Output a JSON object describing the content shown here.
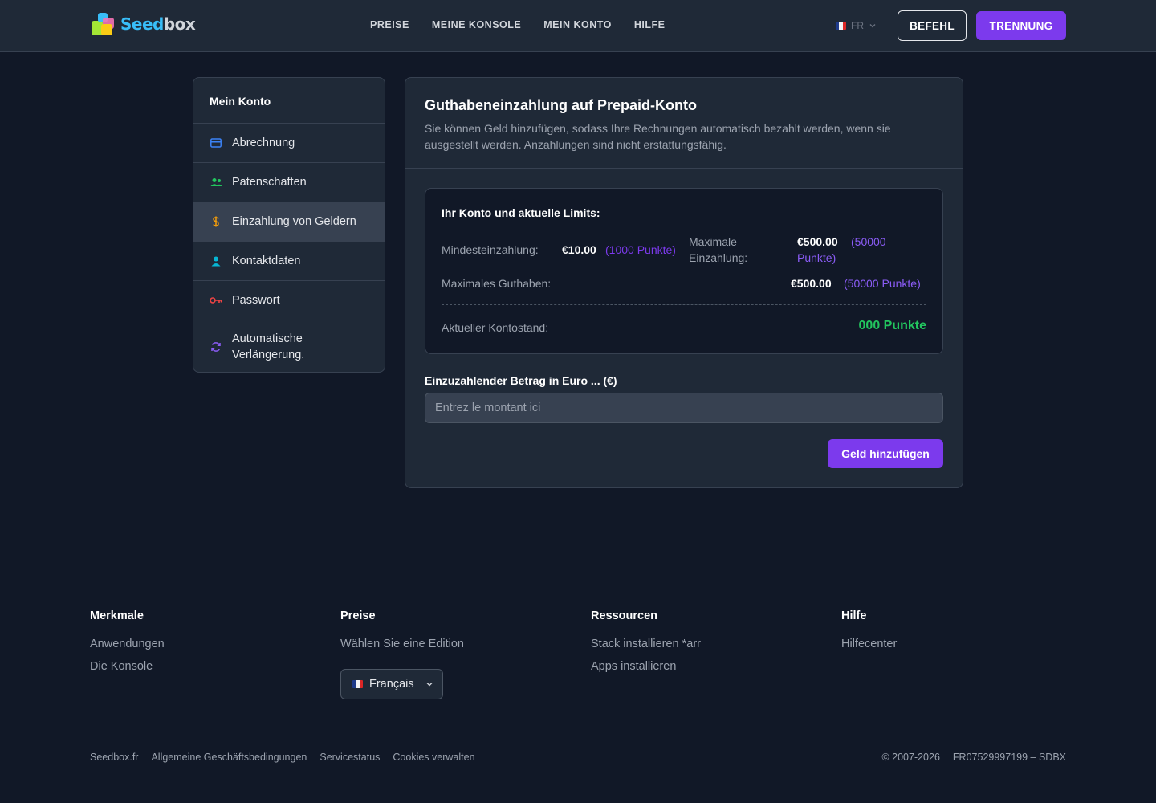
{
  "header": {
    "logo_a": "Seed",
    "logo_b": "box",
    "nav": [
      "PREISE",
      "MEINE KONSOLE",
      "MEIN KONTO",
      "HILFE"
    ],
    "lang": "FR",
    "btn_order": "BEFEHL",
    "btn_logout": "TRENNUNG"
  },
  "sidebar": {
    "title": "Mein Konto",
    "items": [
      {
        "label": "Abrechnung",
        "icon": "credit-card-icon",
        "color": "#3b82f6"
      },
      {
        "label": "Patenschaften",
        "icon": "users-icon",
        "color": "#22c55e"
      },
      {
        "label": "Einzahlung von Geldern",
        "icon": "dollar-icon",
        "color": "#f59e0b"
      },
      {
        "label": "Kontaktdaten",
        "icon": "user-icon",
        "color": "#06b6d4"
      },
      {
        "label": "Passwort",
        "icon": "key-icon",
        "color": "#ef4444"
      },
      {
        "label": "Automatische Verlängerung.",
        "icon": "refresh-icon",
        "color": "#8b5cf6"
      }
    ],
    "active_index": 2
  },
  "main": {
    "title": "Guthabeneinzahlung auf Prepaid-Konto",
    "description": "Sie können Geld hinzufügen, sodass Ihre Rechnungen automatisch bezahlt werden, wenn sie ausgestellt werden. Anzahlungen sind nicht erstattungsfähig.",
    "limits": {
      "title": "Ihr Konto und aktuelle Limits:",
      "min_label": "Mindesteinzahlung:",
      "min_value": "€10.00",
      "min_points": "(1000 Punkte)",
      "max_label": "Maximale Einzahlung:",
      "max_value": "€500.00",
      "max_points": "(50000 Punkte)",
      "max_balance_label": "Maximales Guthaben:",
      "max_balance_value": "€500.00",
      "max_balance_points": "(50000 Punkte)",
      "current_label": "Aktueller Kontostand:",
      "current_value": "000 Punkte"
    },
    "amount_label": "Einzuzahlender Betrag in Euro ... (€)",
    "amount_placeholder": "Entrez le montant ici",
    "add_button": "Geld hinzufügen"
  },
  "footer": {
    "columns": [
      {
        "title": "Merkmale",
        "links": [
          "Anwendungen",
          "Die Konsole"
        ]
      },
      {
        "title": "Preise",
        "links": [
          "Wählen Sie eine Edition"
        ]
      },
      {
        "title": "Ressourcen",
        "links": [
          "Stack installieren *arr",
          "Apps installieren"
        ]
      },
      {
        "title": "Hilfe",
        "links": [
          "Hilfecenter"
        ]
      }
    ],
    "language": "Français",
    "bottom_links": [
      "Seedbox.fr",
      "Allgemeine Geschäftsbedingungen",
      "Servicestatus",
      "Cookies verwalten"
    ],
    "copyright": "© 2007-2026",
    "company_id": "FR07529997199 – SDBX"
  },
  "colors": {
    "accent": "#7c3aed",
    "success": "#22c55e",
    "background": "#111827",
    "surface": "#1f2937"
  }
}
